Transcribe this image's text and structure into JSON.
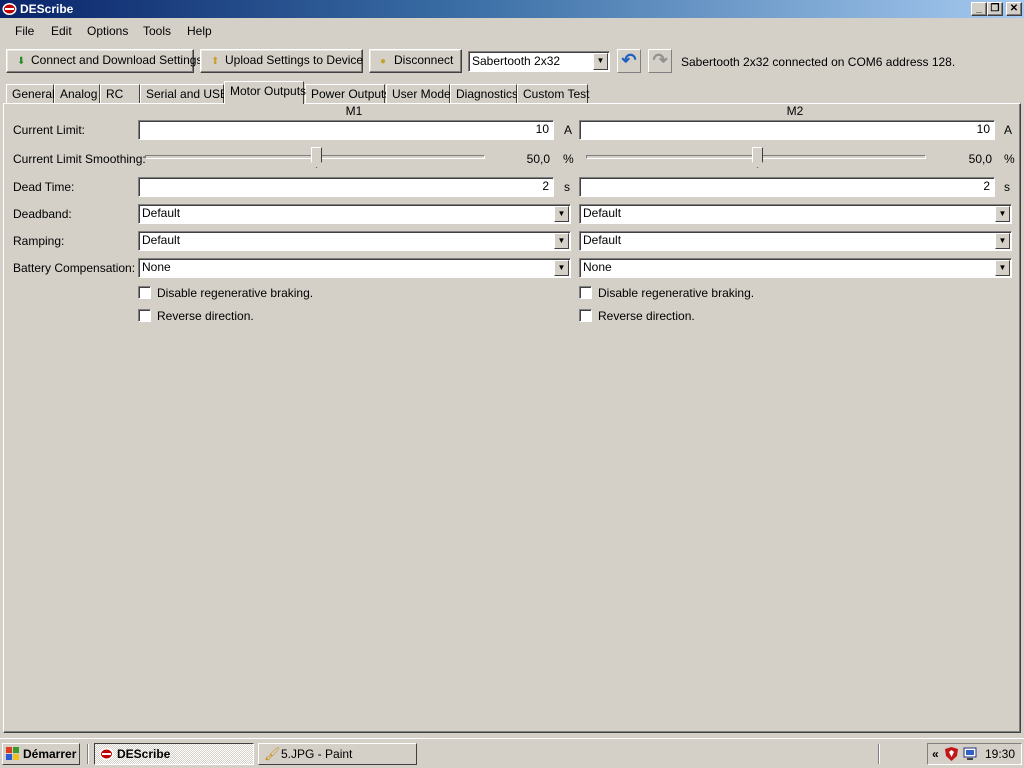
{
  "window": {
    "title": "DEScribe",
    "controls": {
      "minimize": "_",
      "maximize": "❐",
      "close": "✕"
    }
  },
  "menu": [
    "File",
    "Edit",
    "Options",
    "Tools",
    "Help"
  ],
  "toolbar": {
    "connect_label": "Connect and Download Settings",
    "upload_label": "Upload Settings to Device",
    "disconnect_label": "Disconnect",
    "device_selected": "Sabertooth 2x32",
    "undo_icon": "undo-icon",
    "redo_icon": "redo-icon",
    "status": "Sabertooth 2x32 connected on COM6 address 128."
  },
  "tabs": [
    "General",
    "Analog",
    "RC",
    "Serial and USB",
    "Motor Outputs",
    "Power Outputs",
    "User Mode",
    "Diagnostics",
    "Custom Test"
  ],
  "active_tab": "Motor Outputs",
  "motor_outputs": {
    "columns": [
      "M1",
      "M2"
    ],
    "labels": {
      "current_limit": "Current Limit:",
      "current_limit_smoothing": "Current Limit Smoothing:",
      "dead_time": "Dead Time:",
      "deadband": "Deadband:",
      "ramping": "Ramping:",
      "battery_compensation": "Battery Compensation:"
    },
    "m1": {
      "current_limit": "10",
      "current_limit_unit": "A",
      "smoothing_value": "50,0",
      "smoothing_unit": "%",
      "smoothing_fraction": 0.5,
      "dead_time": "2",
      "dead_time_unit": "s",
      "deadband": "Default",
      "ramping": "Default",
      "battery_compensation": "None",
      "disable_regen_label": "Disable regenerative braking.",
      "disable_regen_checked": false,
      "reverse_label": "Reverse direction.",
      "reverse_checked": false
    },
    "m2": {
      "current_limit": "10",
      "current_limit_unit": "A",
      "smoothing_value": "50,0",
      "smoothing_unit": "%",
      "smoothing_fraction": 0.5,
      "dead_time": "2",
      "dead_time_unit": "s",
      "deadband": "Default",
      "ramping": "Default",
      "battery_compensation": "None",
      "disable_regen_label": "Disable regenerative braking.",
      "disable_regen_checked": false,
      "reverse_label": "Reverse direction.",
      "reverse_checked": false
    }
  },
  "taskbar": {
    "start_label": "Démarrer",
    "tasks": [
      "DEScribe",
      "5.JPG - Paint"
    ],
    "tray_chevron": "«",
    "clock": "19:30"
  },
  "colors": {
    "titlebar_start": "#0a246a",
    "titlebar_end": "#a6caf0",
    "undo_blue": "#2060c0",
    "face": "#d4d0c8"
  }
}
